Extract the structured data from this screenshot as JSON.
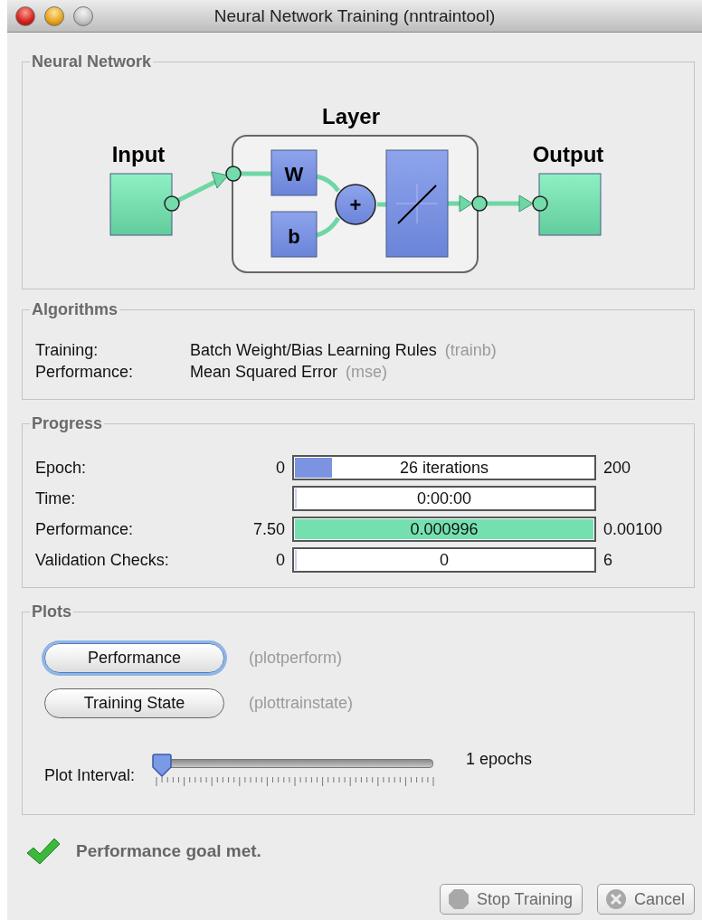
{
  "window": {
    "title": "Neural Network Training (nntraintool)"
  },
  "neural_network": {
    "title": "Neural Network",
    "diagram": {
      "input_label": "Input",
      "layer_label": "Layer",
      "output_label": "Output",
      "weight_label": "W",
      "bias_label": "b",
      "sum_label": "+"
    }
  },
  "algorithms": {
    "title": "Algorithms",
    "rows": [
      {
        "label": "Training:",
        "value": "Batch Weight/Bias Learning Rules",
        "function": "(trainb)"
      },
      {
        "label": "Performance:",
        "value": "Mean Squared Error",
        "function": "(mse)"
      }
    ]
  },
  "progress": {
    "title": "Progress",
    "rows": [
      {
        "label": "Epoch:",
        "min": "0",
        "bar_text": "26 iterations",
        "max": "200",
        "level": 0.13,
        "color": "#7b93e0"
      },
      {
        "label": "Time:",
        "bar_text": "0:00:00",
        "level": 0
      },
      {
        "label": "Performance:",
        "min": "7.50",
        "bar_text": "0.000996",
        "max": "0.00100",
        "level": 1,
        "color": "#74e0b0"
      },
      {
        "label": "Validation Checks:",
        "min": "0",
        "bar_text": "0",
        "max": "6",
        "level": 0
      }
    ]
  },
  "plots": {
    "title": "Plots",
    "buttons": [
      {
        "label": "Performance",
        "function": "(plotperform)",
        "focused": true
      },
      {
        "label": "Training State",
        "function": "(plottrainstate)",
        "focused": false
      }
    ],
    "interval": {
      "label": "Plot Interval:",
      "level": 0,
      "reading": "1 epochs"
    }
  },
  "status": {
    "text": "Performance goal met."
  },
  "buttons": [
    {
      "label": "Stop Training",
      "kind": "stop",
      "disabled": true
    },
    {
      "label": "Cancel",
      "kind": "cancel",
      "disabled": true
    }
  ]
}
